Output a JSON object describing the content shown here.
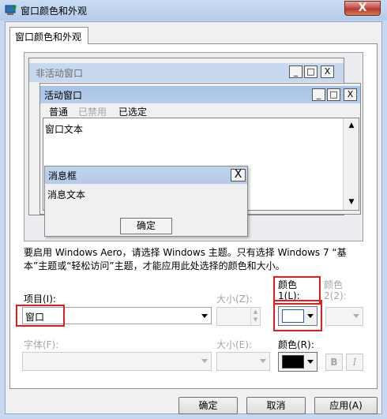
{
  "window": {
    "title": "窗口颜色和外观",
    "close_symbol": "X"
  },
  "tabs": [
    {
      "label": "窗口颜色和外观"
    }
  ],
  "preview": {
    "inactive_window_title": "非活动窗口",
    "active_window_title": "活动窗口",
    "menu_items": [
      {
        "label": "普通",
        "state": "normal"
      },
      {
        "label": "已禁用",
        "state": "disabled"
      },
      {
        "label": "已选定",
        "state": "selected"
      }
    ],
    "window_text": "窗口文本",
    "message_box": {
      "title": "消息框",
      "text": "消息文本",
      "ok_label": "确定",
      "close_symbol": "X"
    },
    "caption_buttons": {
      "minimize": "_",
      "maximize": "□",
      "close": "X"
    }
  },
  "notice": "要启用 Windows Aero，请选择 Windows 主题。只有选择 Windows 7 “基本”主题或“轻松访问”主题，才能应用此处选择的颜色和大小。",
  "item": {
    "label": "项目(I):",
    "value": "窗口"
  },
  "size1": {
    "label": "大小(Z):"
  },
  "color1": {
    "label_line1": "颜色",
    "label_line2": "1(L):",
    "swatch_color": "#ffffff"
  },
  "color2": {
    "label_line1": "颜色",
    "label_line2": "2(2):"
  },
  "font": {
    "label": "字体(F):"
  },
  "font_size": {
    "label": "大小(E):"
  },
  "font_color": {
    "label": "颜色(R):",
    "swatch_color": "#000000"
  },
  "format_buttons": {
    "bold": "B",
    "italic": "I"
  },
  "buttons": {
    "ok": "确定",
    "cancel": "取消",
    "apply": "应用(A)"
  },
  "colors": {
    "highlight": "#e02020"
  }
}
